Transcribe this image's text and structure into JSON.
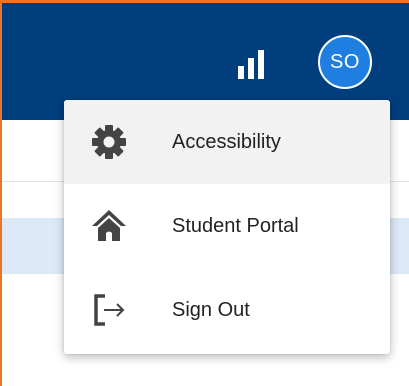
{
  "header": {
    "signal_icon": "signal-bars-icon",
    "avatar_initials": "SO"
  },
  "user_menu": {
    "items": [
      {
        "label": "Accessibility",
        "icon": "gear-icon"
      },
      {
        "label": "Student Portal",
        "icon": "home-icon"
      },
      {
        "label": "Sign Out",
        "icon": "sign-out-icon"
      }
    ]
  },
  "colors": {
    "header_bg": "#003e7e",
    "avatar_bg": "#1f7fe0",
    "frame_border": "#e8752e",
    "active_item_bg": "#f2f2f2",
    "icon_color": "#444444"
  }
}
